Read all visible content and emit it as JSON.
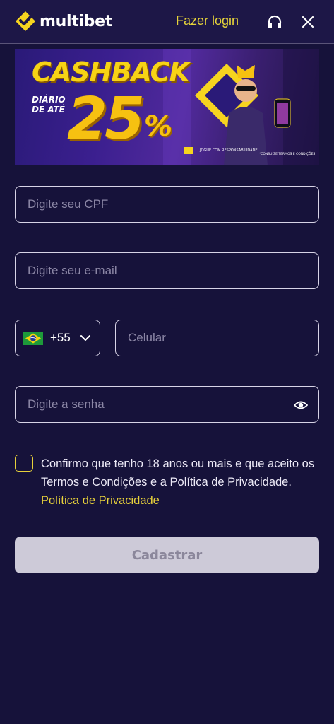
{
  "header": {
    "logo_text": "multibet",
    "login_label": "Fazer login",
    "icons": [
      "logo-icon",
      "headset-icon",
      "close-icon"
    ]
  },
  "banner": {
    "headline": "CASHBACK",
    "subline": "DIÁRIO DE ATÉ",
    "percent": "25",
    "percent_sign": "%",
    "responsibility": "JOGUE COM RESPONSABILIDADE",
    "terms": "*CONSULTE TERMOS E CONDIÇÕES"
  },
  "form": {
    "cpf_placeholder": "Digite seu CPF",
    "email_placeholder": "Digite seu e-mail",
    "country_code": "+55",
    "country_flag": "brazil-flag-icon",
    "phone_placeholder": "Celular",
    "password_placeholder": "Digite a senha",
    "consent_text": "Confirmo que tenho 18 anos ou mais e que aceito os Termos e Condições e a Política de Privacidade. ",
    "privacy_link": "Política de Privacidade",
    "submit_label": "Cadastrar"
  },
  "colors": {
    "background": "#16123a",
    "accent": "#e6d03b",
    "field_border": "#d7d3e6",
    "button_disabled": "#cdcad8"
  }
}
